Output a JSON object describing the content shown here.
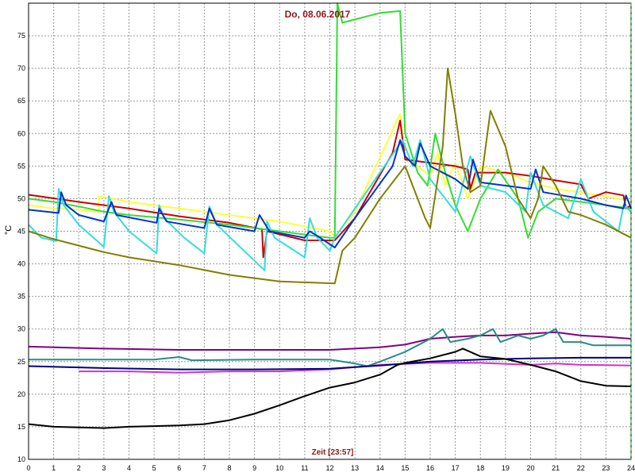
{
  "chart_data": {
    "type": "line",
    "title": "Do, 08.06.2017",
    "xlabel": "Zeit [23:57]",
    "ylabel": "°C",
    "xlim": [
      0,
      24
    ],
    "ylim": [
      10,
      80
    ],
    "xticks": [
      0,
      1,
      2,
      3,
      4,
      5,
      6,
      7,
      8,
      9,
      10,
      11,
      12,
      13,
      14,
      15,
      16,
      17,
      18,
      19,
      20,
      21,
      22,
      23,
      24
    ],
    "yticks": [
      10,
      15,
      20,
      25,
      30,
      35,
      40,
      45,
      50,
      55,
      60,
      65,
      70,
      75
    ],
    "grid": true,
    "series": [
      {
        "color": "#ffff33",
        "points": [
          [
            0,
            49
          ],
          [
            1,
            48.5
          ],
          [
            2,
            48.3
          ],
          [
            2.8,
            48
          ],
          [
            2.8,
            50.4
          ],
          [
            4,
            49.5
          ],
          [
            6,
            48.5
          ],
          [
            8,
            47.5
          ],
          [
            10,
            46.5
          ],
          [
            12,
            45
          ],
          [
            12.2,
            44.2
          ],
          [
            13,
            48
          ],
          [
            14.8,
            63
          ],
          [
            15,
            56
          ],
          [
            15.5,
            55
          ],
          [
            16,
            53.5
          ],
          [
            16.3,
            57
          ],
          [
            16.6,
            52
          ],
          [
            17,
            55.5
          ],
          [
            17.5,
            50
          ],
          [
            18,
            55
          ],
          [
            19,
            54
          ],
          [
            20,
            52.5
          ],
          [
            21,
            51.5
          ],
          [
            22,
            51
          ],
          [
            23.5,
            50
          ],
          [
            24,
            49.5
          ]
        ]
      },
      {
        "color": "#cc0000",
        "points": [
          [
            0,
            50.6
          ],
          [
            2,
            49.5
          ],
          [
            4,
            48.5
          ],
          [
            6,
            47.3
          ],
          [
            8,
            46.3
          ],
          [
            9.3,
            45.3
          ],
          [
            9.35,
            41
          ],
          [
            9.5,
            45
          ],
          [
            11,
            43.6
          ],
          [
            12.2,
            43.6
          ],
          [
            13,
            47
          ],
          [
            14.5,
            57
          ],
          [
            14.8,
            62
          ],
          [
            15,
            56
          ],
          [
            16,
            55.5
          ],
          [
            17,
            55
          ],
          [
            17.5,
            54.5
          ],
          [
            17.6,
            51.5
          ],
          [
            17.8,
            54
          ],
          [
            19,
            54
          ],
          [
            20,
            53.5
          ],
          [
            21,
            52.8
          ],
          [
            22,
            52.2
          ],
          [
            22.3,
            50
          ],
          [
            23,
            51
          ],
          [
            23.7,
            50.5
          ],
          [
            23.8,
            48.5
          ],
          [
            24,
            49
          ]
        ]
      },
      {
        "color": "#33dd33",
        "points": [
          [
            0,
            50
          ],
          [
            1,
            49.5
          ],
          [
            2,
            48.8
          ],
          [
            3,
            48
          ],
          [
            4,
            47.5
          ],
          [
            6,
            46.8
          ],
          [
            8,
            46
          ],
          [
            10,
            45
          ],
          [
            12,
            44
          ],
          [
            12.2,
            44
          ],
          [
            12.3,
            80
          ],
          [
            12.5,
            77
          ],
          [
            13,
            77.5
          ],
          [
            14,
            78.5
          ],
          [
            14.8,
            78.8
          ],
          [
            15,
            60
          ],
          [
            15.5,
            54
          ],
          [
            15.9,
            52
          ],
          [
            16.2,
            60
          ],
          [
            16.6,
            54
          ],
          [
            17,
            49
          ],
          [
            17.5,
            45
          ],
          [
            18,
            50
          ],
          [
            18.7,
            54.5
          ],
          [
            19.5,
            50
          ],
          [
            19.9,
            44
          ],
          [
            20.3,
            48
          ],
          [
            21,
            50
          ],
          [
            22,
            49.5
          ],
          [
            23,
            49
          ],
          [
            24,
            48.5
          ]
        ]
      },
      {
        "color": "#33dddd",
        "points": [
          [
            0,
            46
          ],
          [
            0.5,
            44
          ],
          [
            1.1,
            43.5
          ],
          [
            1.2,
            51.5
          ],
          [
            1.4,
            49
          ],
          [
            2,
            46
          ],
          [
            3,
            42.6
          ],
          [
            3.2,
            50.4
          ],
          [
            3.4,
            48
          ],
          [
            4,
            45
          ],
          [
            5.1,
            41.6
          ],
          [
            5.2,
            49
          ],
          [
            5.4,
            47
          ],
          [
            6.2,
            44
          ],
          [
            7,
            41.6
          ],
          [
            7.2,
            48.8
          ],
          [
            7.5,
            46
          ],
          [
            9.4,
            39
          ],
          [
            9.5,
            46.5
          ],
          [
            9.8,
            44
          ],
          [
            11,
            41
          ],
          [
            11.2,
            47
          ],
          [
            11.5,
            44
          ],
          [
            12,
            42
          ],
          [
            12.2,
            44
          ],
          [
            13,
            48.5
          ],
          [
            14.9,
            59
          ],
          [
            15.3,
            55
          ],
          [
            15.6,
            59
          ],
          [
            16,
            53
          ],
          [
            17,
            48
          ],
          [
            17.6,
            56.5
          ],
          [
            18,
            52
          ],
          [
            19,
            51
          ],
          [
            19.8,
            48
          ],
          [
            20,
            54
          ],
          [
            20.5,
            49
          ],
          [
            21.5,
            47
          ],
          [
            22,
            53
          ],
          [
            22.5,
            48
          ],
          [
            23.5,
            45
          ],
          [
            23.7,
            49
          ],
          [
            24,
            48
          ]
        ]
      },
      {
        "color": "#0033cc",
        "points": [
          [
            0,
            48.3
          ],
          [
            1.2,
            47.8
          ],
          [
            1.3,
            51
          ],
          [
            1.5,
            49
          ],
          [
            2,
            47.5
          ],
          [
            3,
            46.5
          ],
          [
            3.3,
            49.5
          ],
          [
            3.5,
            47.5
          ],
          [
            5.1,
            46.3
          ],
          [
            5.2,
            48.5
          ],
          [
            5.5,
            46.5
          ],
          [
            7,
            45.5
          ],
          [
            7.2,
            48.5
          ],
          [
            7.5,
            46
          ],
          [
            9,
            45
          ],
          [
            9.2,
            47.5
          ],
          [
            9.6,
            45
          ],
          [
            11,
            44
          ],
          [
            11.2,
            45
          ],
          [
            11.5,
            44.3
          ],
          [
            12.2,
            42.5
          ],
          [
            13,
            47
          ],
          [
            14.5,
            55
          ],
          [
            14.8,
            59
          ],
          [
            15,
            56.5
          ],
          [
            15.4,
            55
          ],
          [
            15.6,
            58.5
          ],
          [
            16,
            55
          ],
          [
            17,
            53
          ],
          [
            17.5,
            51.5
          ],
          [
            17.7,
            56
          ],
          [
            18,
            52.5
          ],
          [
            19,
            52
          ],
          [
            20,
            51.5
          ],
          [
            20.2,
            54.5
          ],
          [
            20.5,
            51
          ],
          [
            22,
            50
          ],
          [
            23,
            49
          ],
          [
            23.7,
            48.5
          ],
          [
            23.8,
            50.5
          ],
          [
            24,
            48.5
          ]
        ]
      },
      {
        "color": "#808000",
        "points": [
          [
            0,
            45
          ],
          [
            1,
            43.8
          ],
          [
            2,
            42.8
          ],
          [
            3,
            41.8
          ],
          [
            4,
            41
          ],
          [
            6,
            39.8
          ],
          [
            8,
            38.3
          ],
          [
            10,
            37.3
          ],
          [
            12.2,
            37
          ],
          [
            12.5,
            42
          ],
          [
            13,
            44
          ],
          [
            14,
            50
          ],
          [
            15,
            55
          ],
          [
            15.3,
            52
          ],
          [
            15.8,
            47
          ],
          [
            16,
            45.5
          ],
          [
            16.5,
            58
          ],
          [
            16.7,
            70
          ],
          [
            17,
            63
          ],
          [
            17.3,
            55
          ],
          [
            17.6,
            51
          ],
          [
            18,
            52
          ],
          [
            18.4,
            63.5
          ],
          [
            19,
            58
          ],
          [
            19.5,
            50
          ],
          [
            20,
            47
          ],
          [
            20.3,
            50
          ],
          [
            20.5,
            55
          ],
          [
            21,
            52
          ],
          [
            21.5,
            48
          ],
          [
            22,
            47.5
          ],
          [
            23,
            46
          ],
          [
            24,
            44
          ]
        ]
      },
      {
        "color": "#800080",
        "points": [
          [
            0,
            27.3
          ],
          [
            3,
            27
          ],
          [
            6,
            26.8
          ],
          [
            9,
            26.8
          ],
          [
            12,
            26.8
          ],
          [
            14,
            27.2
          ],
          [
            15,
            27.6
          ],
          [
            16,
            28.5
          ],
          [
            17,
            28.8
          ],
          [
            18,
            29
          ],
          [
            19,
            29
          ],
          [
            20,
            29.3
          ],
          [
            21,
            29.5
          ],
          [
            22,
            29
          ],
          [
            23,
            28.8
          ],
          [
            24,
            28.5
          ]
        ]
      },
      {
        "color": "#2a8a8a",
        "points": [
          [
            0,
            25.3
          ],
          [
            5,
            25.3
          ],
          [
            6,
            25.7
          ],
          [
            6.5,
            25.2
          ],
          [
            9,
            25.3
          ],
          [
            12,
            25.3
          ],
          [
            13,
            24.7
          ],
          [
            13.5,
            24.3
          ],
          [
            14,
            25
          ],
          [
            15,
            26.5
          ],
          [
            15.5,
            27.5
          ],
          [
            16,
            28.5
          ],
          [
            16.5,
            30
          ],
          [
            16.8,
            28
          ],
          [
            17.5,
            28.5
          ],
          [
            18,
            29
          ],
          [
            18.5,
            30
          ],
          [
            18.8,
            28
          ],
          [
            19.5,
            29
          ],
          [
            20,
            28.5
          ],
          [
            20.5,
            29
          ],
          [
            21,
            30
          ],
          [
            21.3,
            28
          ],
          [
            22,
            28
          ],
          [
            22.5,
            27.5
          ],
          [
            23,
            27.5
          ],
          [
            24,
            27.5
          ]
        ]
      },
      {
        "color": "#cc33cc",
        "points": [
          [
            2,
            23.5
          ],
          [
            4,
            23.5
          ],
          [
            6,
            23.3
          ],
          [
            8,
            23.5
          ],
          [
            10,
            23.5
          ],
          [
            12,
            23.8
          ],
          [
            14,
            24.5
          ],
          [
            16,
            24.8
          ],
          [
            18,
            24.8
          ],
          [
            20,
            24.5
          ],
          [
            21,
            24.7
          ],
          [
            22,
            24.5
          ],
          [
            24,
            24.4
          ]
        ]
      },
      {
        "color": "#000080",
        "points": [
          [
            0,
            24.3
          ],
          [
            3,
            24
          ],
          [
            6,
            23.8
          ],
          [
            9,
            23.8
          ],
          [
            12,
            23.9
          ],
          [
            14,
            24.4
          ],
          [
            15,
            24.7
          ],
          [
            16,
            25
          ],
          [
            18,
            25.3
          ],
          [
            20,
            25.5
          ],
          [
            22,
            25.6
          ],
          [
            24,
            25.6
          ]
        ]
      },
      {
        "color": "#000000",
        "points": [
          [
            0,
            15.4
          ],
          [
            1,
            15
          ],
          [
            2,
            14.9
          ],
          [
            3,
            14.8
          ],
          [
            4,
            15
          ],
          [
            5,
            15.1
          ],
          [
            6,
            15.2
          ],
          [
            7,
            15.4
          ],
          [
            8,
            16
          ],
          [
            9,
            17
          ],
          [
            10,
            18.3
          ],
          [
            11,
            19.7
          ],
          [
            12,
            21
          ],
          [
            13,
            21.8
          ],
          [
            14,
            23
          ],
          [
            14.7,
            24.5
          ],
          [
            15,
            24.8
          ],
          [
            16,
            25.5
          ],
          [
            17,
            26.5
          ],
          [
            17.3,
            27
          ],
          [
            18,
            25.8
          ],
          [
            19,
            25.4
          ],
          [
            20,
            24.5
          ],
          [
            21,
            23.5
          ],
          [
            22,
            22
          ],
          [
            23,
            21.3
          ],
          [
            24,
            21.2
          ]
        ]
      }
    ]
  }
}
